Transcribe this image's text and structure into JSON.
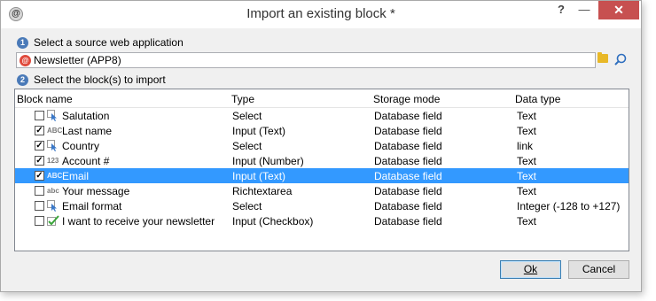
{
  "window": {
    "title": "Import an existing block *",
    "help_glyph": "?",
    "minimize_glyph": "—",
    "close_glyph": "✕",
    "app_icon_glyph": "@"
  },
  "step1": {
    "number": "1",
    "label": "Select a source web application"
  },
  "source_app": {
    "value": "Newsletter (APP8)",
    "icon": "web-app-icon"
  },
  "step2": {
    "number": "2",
    "label": "Select the block(s) to import"
  },
  "table": {
    "columns": [
      "Block name",
      "Type",
      "Storage mode",
      "Data type"
    ],
    "rows": [
      {
        "checked": false,
        "icon": "select-icon",
        "icon_text": "",
        "name": "Salutation",
        "type": "Select",
        "storage": "Database field",
        "data_type": "Text",
        "selected": false
      },
      {
        "checked": true,
        "icon": "text-input-icon",
        "icon_text": "ABC",
        "name": "Last name",
        "type": "Input (Text)",
        "storage": "Database field",
        "data_type": "Text",
        "selected": false
      },
      {
        "checked": true,
        "icon": "select-icon",
        "icon_text": "",
        "name": "Country",
        "type": "Select",
        "storage": "Database field",
        "data_type": "link",
        "selected": false
      },
      {
        "checked": true,
        "icon": "number-input-icon",
        "icon_text": "123",
        "name": "Account #",
        "type": "Input (Number)",
        "storage": "Database field",
        "data_type": "Text",
        "selected": false
      },
      {
        "checked": true,
        "icon": "text-input-icon",
        "icon_text": "ABC",
        "name": "Email",
        "type": "Input (Text)",
        "storage": "Database field",
        "data_type": "Text",
        "selected": true
      },
      {
        "checked": false,
        "icon": "richtext-icon",
        "icon_text": "abc",
        "name": "Your message",
        "type": "Richtextarea",
        "storage": "Database field",
        "data_type": "Text",
        "selected": false
      },
      {
        "checked": false,
        "icon": "select-icon",
        "icon_text": "",
        "name": "Email format",
        "type": "Select",
        "storage": "Database field",
        "data_type": "Integer (-128 to +127)",
        "selected": false
      },
      {
        "checked": false,
        "icon": "checkbox-icon",
        "icon_text": "",
        "name": "I want to receive your newsletter",
        "type": "Input (Checkbox)",
        "storage": "Database field",
        "data_type": "Text",
        "selected": false
      }
    ]
  },
  "buttons": {
    "ok_label": "Ok",
    "cancel_label": "Cancel"
  },
  "colors": {
    "selection": "#3399ff",
    "close": "#c75050",
    "step_badge": "#4a7ab8"
  }
}
